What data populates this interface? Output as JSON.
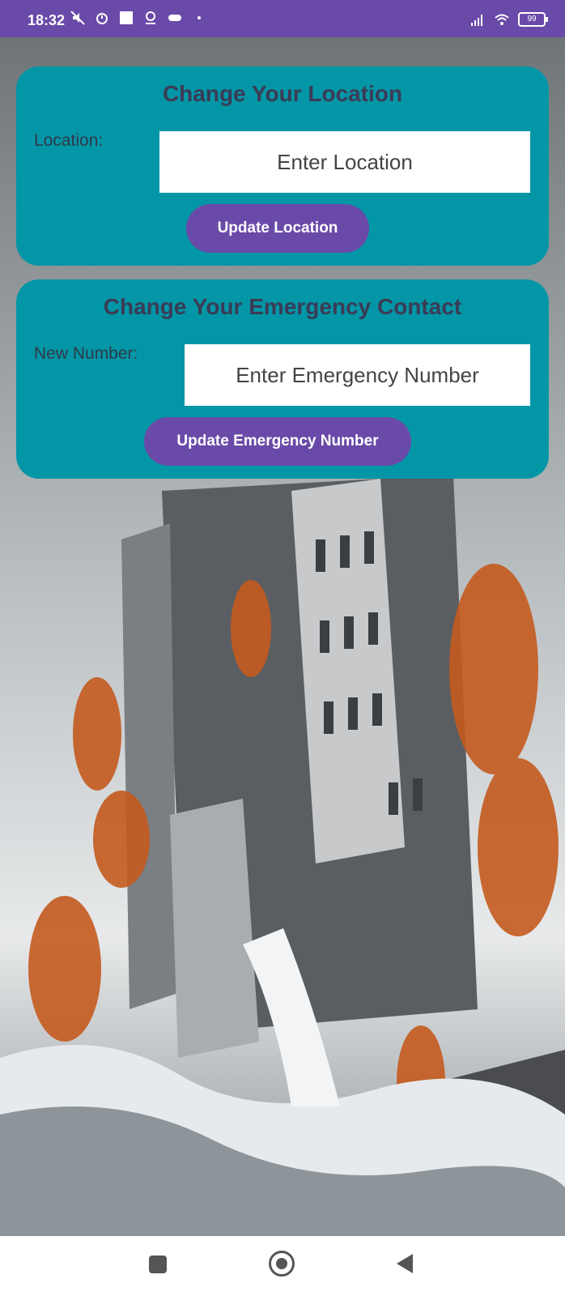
{
  "status_bar": {
    "time": "18:32",
    "battery": "99",
    "icons_left": [
      "mute-icon",
      "alarm-icon",
      "square-icon",
      "location-icon",
      "gamepad-icon",
      "dot-icon"
    ],
    "icons_right": [
      "signal-icon",
      "wifi-icon",
      "battery-icon"
    ]
  },
  "location_card": {
    "title": "Change Your Location",
    "label": "Location:",
    "placeholder": "Enter Location",
    "button_label": "Update Location"
  },
  "emergency_card": {
    "title": "Change Your Emergency Contact",
    "label": "New Number:",
    "placeholder": "Enter Emergency Number",
    "button_label": "Update Emergency Number"
  },
  "colors": {
    "status_bar": "#6a4aa8",
    "card": "#0396a6",
    "button": "#6a4aa8",
    "title_text": "#3b3b55"
  },
  "nav_bar": {
    "icons": [
      "recents-icon",
      "home-icon",
      "back-icon"
    ]
  }
}
